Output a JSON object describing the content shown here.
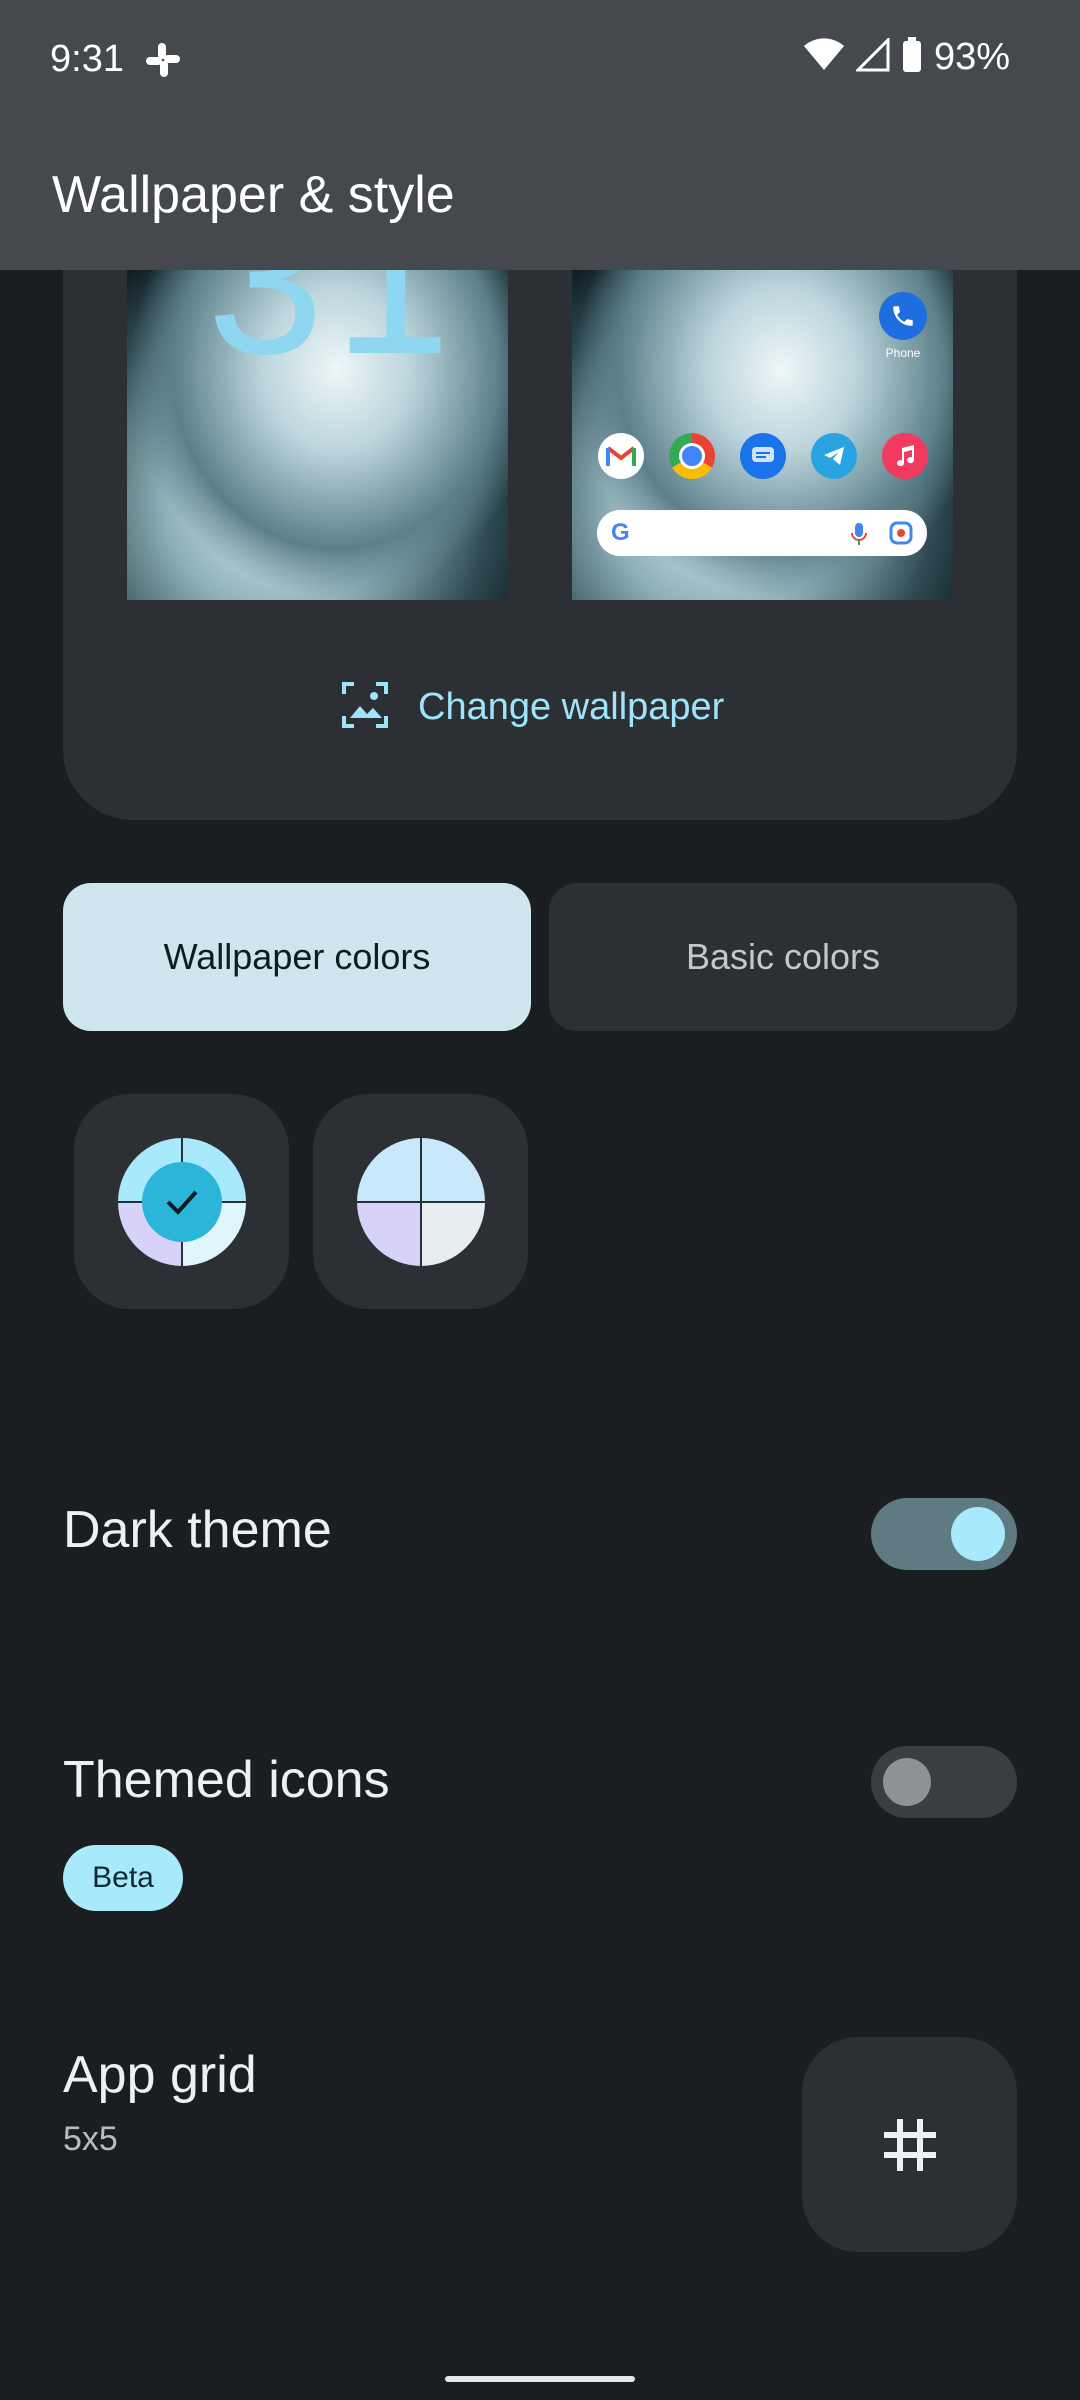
{
  "status": {
    "time": "9:31",
    "battery": "93%"
  },
  "appbar": {
    "title": "Wallpaper & style"
  },
  "preview": {
    "lock_digits": "31",
    "phone_label": "Phone",
    "change_wallpaper": "Change wallpaper"
  },
  "tabs": {
    "wallpaper_colors": "Wallpaper colors",
    "basic_colors": "Basic colors"
  },
  "settings": {
    "dark_theme": {
      "label": "Dark theme",
      "on": true
    },
    "themed_icons": {
      "label": "Themed icons",
      "badge": "Beta",
      "on": false
    },
    "app_grid": {
      "label": "App grid",
      "value": "5x5"
    }
  },
  "colors": {
    "accent": "#9ee4fb",
    "background": "#1b1e21",
    "card": "#2c3034",
    "active_tab": "#cfe6ee"
  }
}
